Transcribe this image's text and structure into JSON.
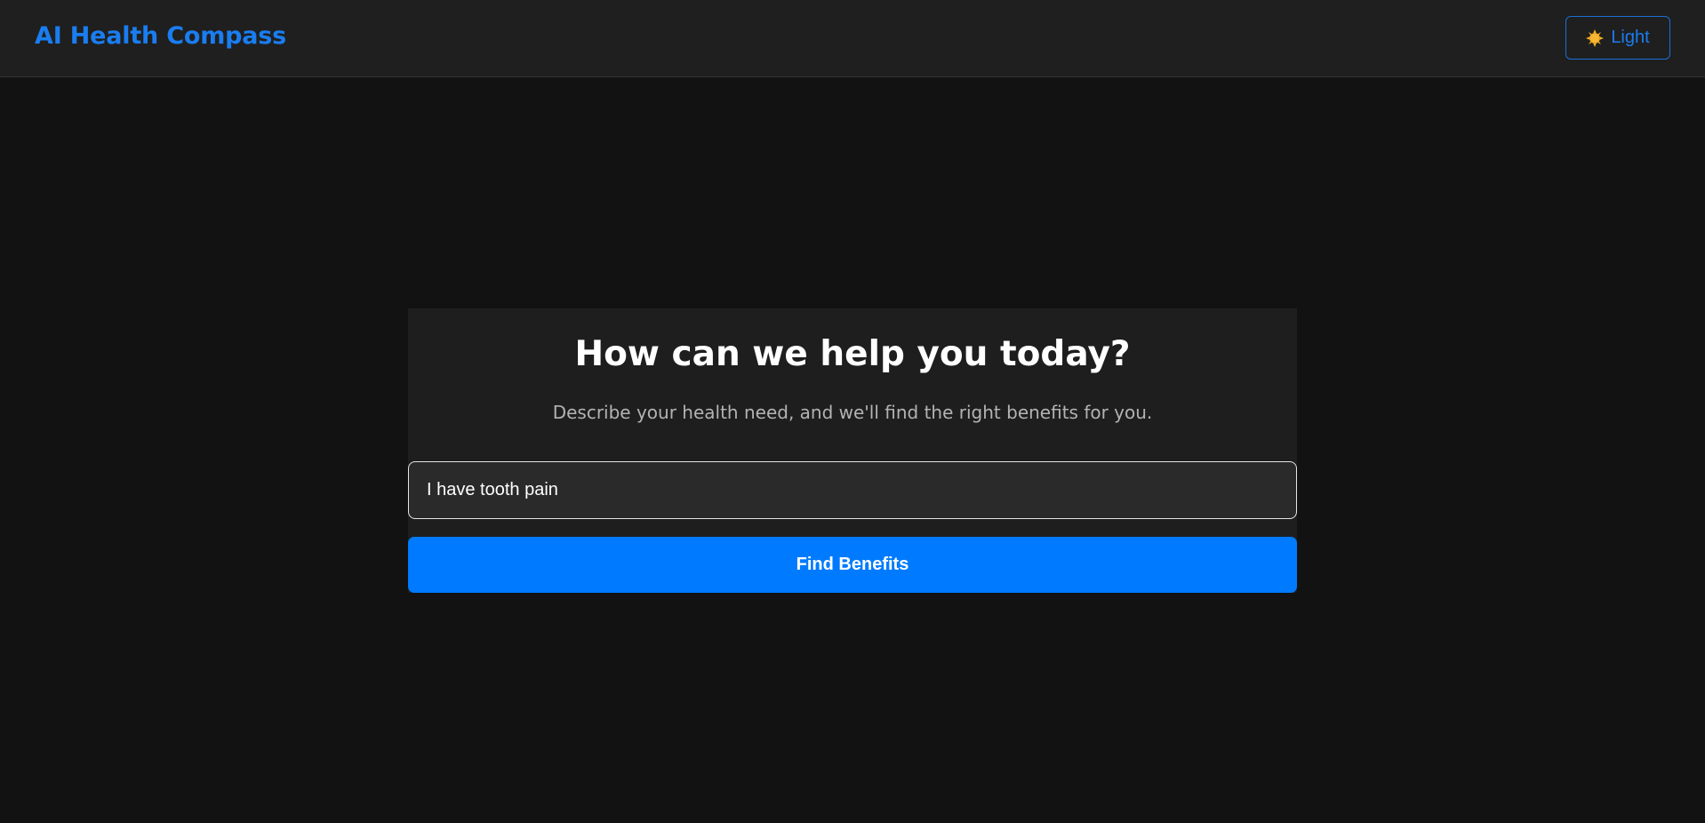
{
  "header": {
    "brand": "AI Health Compass",
    "theme_toggle": {
      "icon": "sun-icon",
      "label": "Light"
    }
  },
  "main": {
    "title": "How can we help you today?",
    "subtitle": "Describe your health need, and we'll find the right benefits for you.",
    "query_input": {
      "value": "I have tooth pain"
    },
    "submit_label": "Find Benefits"
  },
  "colors": {
    "background": "#121212",
    "header_background": "#1f1f1f",
    "card_background": "#1e1e1e",
    "accent": "#007bff",
    "brand": "#1a7df0",
    "sun": "#f5b623"
  }
}
